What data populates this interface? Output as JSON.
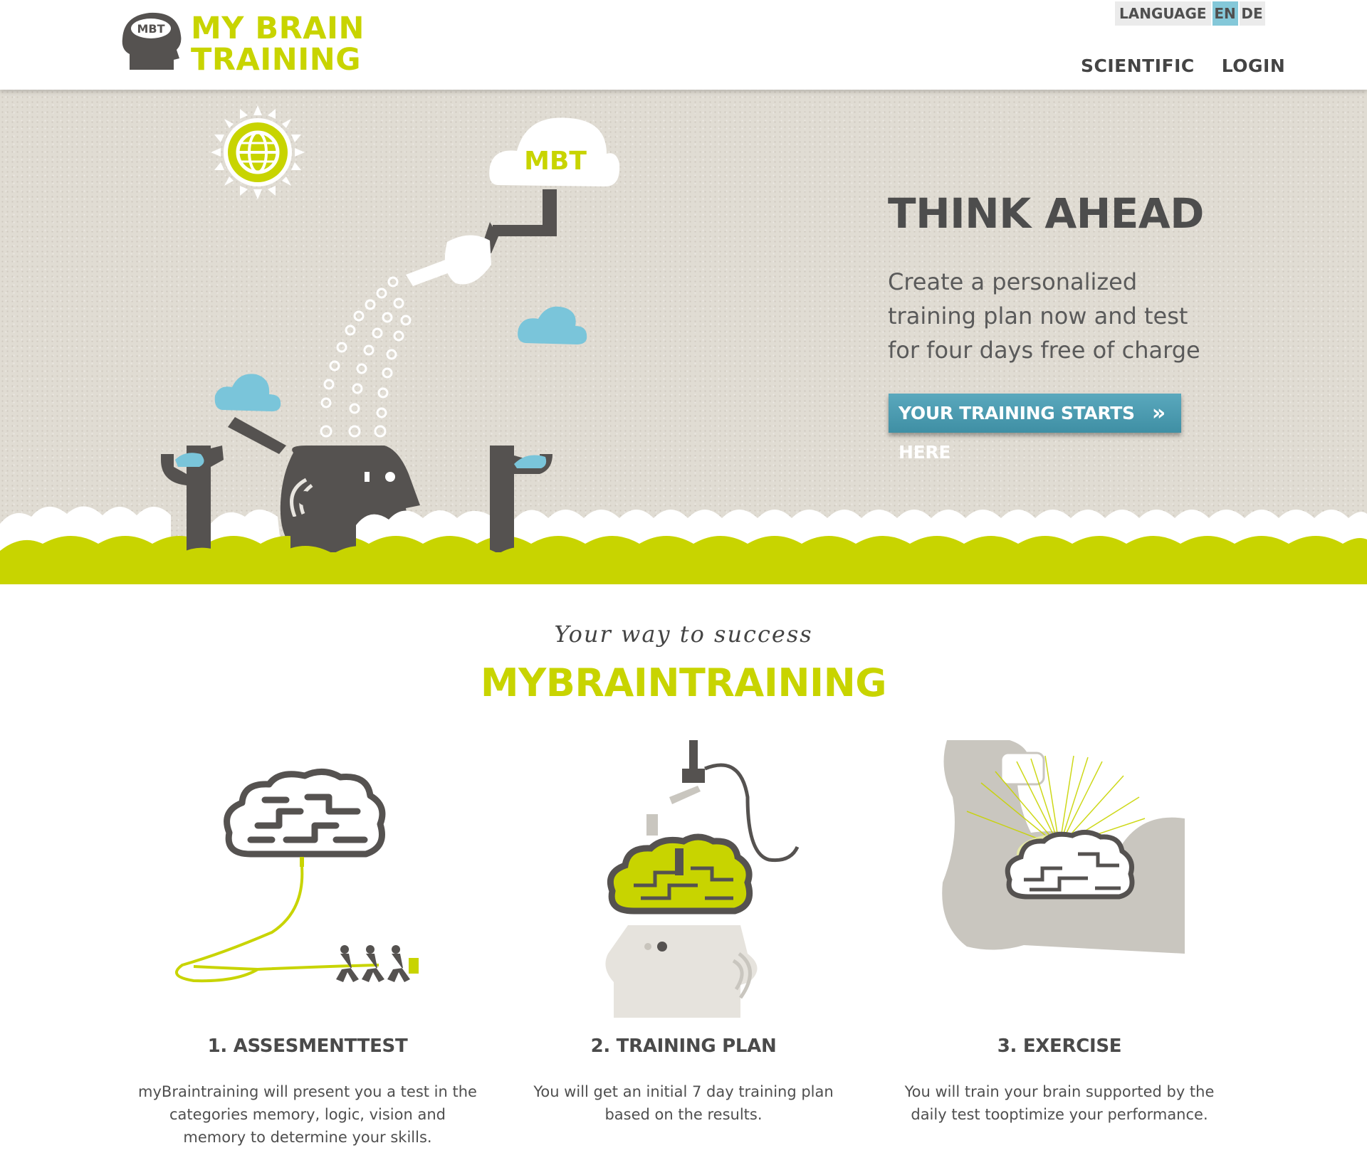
{
  "header": {
    "logo": {
      "badge": "MBT",
      "line1": "MY BRAIN",
      "line2": "TRAINING"
    },
    "language": {
      "label": "LANGUAGE",
      "options": [
        {
          "code": "EN",
          "active": true
        },
        {
          "code": "DE",
          "active": false
        }
      ]
    },
    "nav": [
      {
        "label": "SCIENTIFIC"
      },
      {
        "label": "LOGIN"
      }
    ]
  },
  "hero": {
    "cloud_label": "MBT",
    "title": "THINK AHEAD",
    "subtitle": "Create a personalized training plan now and test for four days free of charge",
    "cta": {
      "label": "YOUR TRAINING STARTS HERE",
      "icon": "double-chevron-right-icon"
    }
  },
  "section": {
    "tagline": "Your way to success",
    "title": "MYBRAINTRAINING",
    "steps": [
      {
        "title": "1. ASSESMENTTEST",
        "description": "myBraintraining will present you a test in the categories memory, logic, vision and memory to determine your skills.",
        "icon": "brain-cable-runners-illustration"
      },
      {
        "title": "2. TRAINING PLAN",
        "description": "You will get an initial 7 day training plan based on the results.",
        "icon": "brain-plug-head-illustration"
      },
      {
        "title": "3. EXERCISE",
        "description": "You will train your brain supported by the daily test tooptimize your performance.",
        "icon": "flexed-arm-brain-illustration"
      }
    ]
  },
  "colors": {
    "brand_green": "#c8d400",
    "accent_blue": "#84c8d9",
    "button_blue": "#4b9bb1",
    "dark_gray": "#555250",
    "paper": "#e0dcd3"
  }
}
